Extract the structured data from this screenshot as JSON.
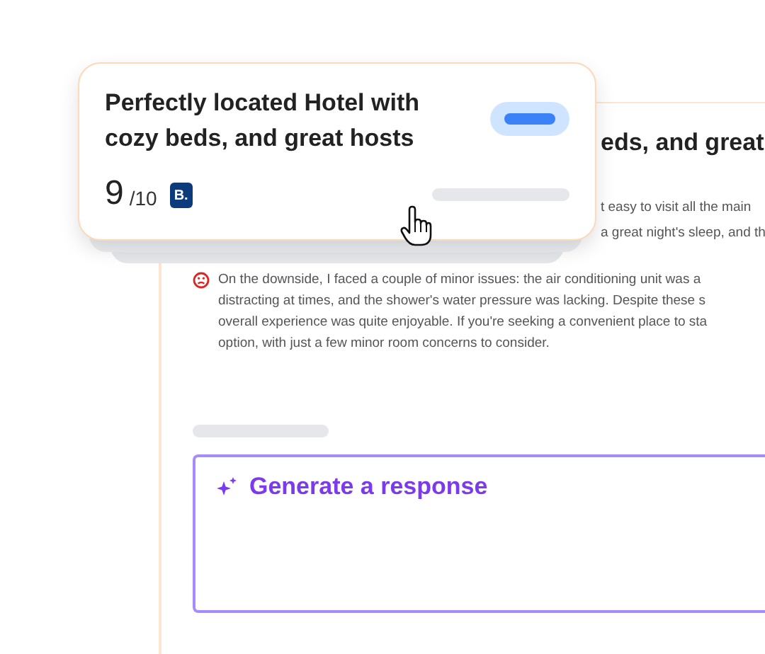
{
  "review_panel": {
    "title_fragment": "eds, and great",
    "positive_fragments": [
      "t easy to visit all the main",
      "a great night's sleep, and th"
    ],
    "negative": {
      "kind": "negative",
      "lines": [
        "On the downside, I faced a couple of minor issues: the air conditioning unit was a",
        "distracting at times, and the shower's water pressure was lacking. Despite these s",
        "overall experience was quite enjoyable. If you're seeking a convenient place to sta",
        "option, with just a few minor room concerns to consider."
      ]
    },
    "response": {
      "label": "Generate a response"
    }
  },
  "card": {
    "title": "Perfectly located Hotel with cozy beds, and great hosts",
    "score": "9",
    "scale": "/10",
    "source_badge": "B.",
    "toggle": {
      "on": true
    }
  }
}
